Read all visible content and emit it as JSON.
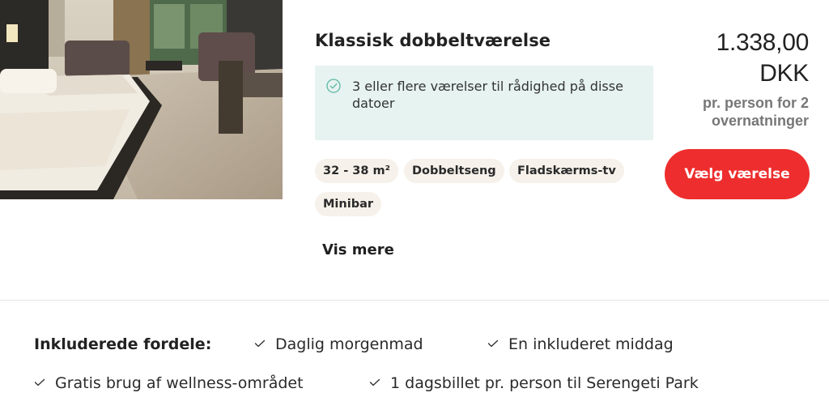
{
  "room": {
    "title": "Klassisk dobbeltværelse",
    "availability": "3 eller flere værelser til rådighed på disse datoer",
    "tags": [
      "32 - 38 m²",
      "Dobbeltseng",
      "Fladskærms-tv",
      "Minibar"
    ],
    "show_more": "Vis mere"
  },
  "price": {
    "amount": "1.338,00",
    "currency": "DKK",
    "note_line1": "pr. person for 2",
    "note_line2": "overnatninger"
  },
  "select_button": "Vælg værelse",
  "benefits": {
    "label": "Inkluderede fordele:",
    "items": [
      "Daglig morgenmad",
      "En inkluderet middag",
      "Gratis brug af wellness-området",
      "1 dagsbillet pr. person til Serengeti Park"
    ]
  },
  "colors": {
    "accent": "#ee2e2e",
    "availability_bg": "#e6f3f0",
    "check": "#5bb8a3",
    "tag_bg": "#f6f1ea"
  }
}
